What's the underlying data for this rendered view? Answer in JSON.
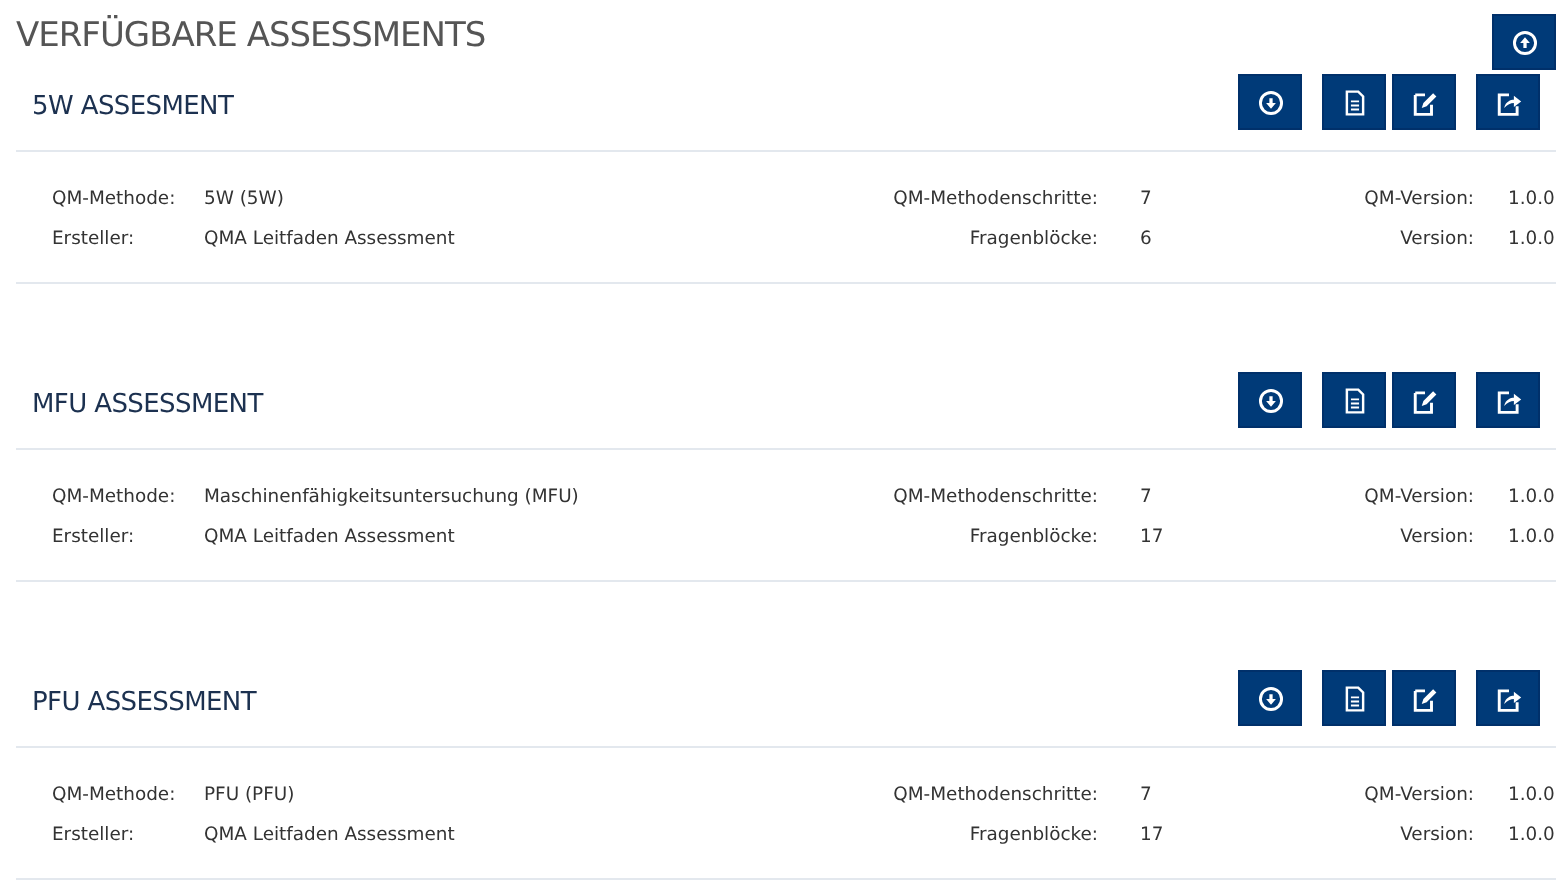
{
  "title": "VERFÜGBARE ASSESSMENTS",
  "header_action": {
    "kind": "upload"
  },
  "assessments": [
    {
      "name": "5W ASSESMENT",
      "actions": [
        {
          "kind": "download"
        },
        {
          "kind": "document"
        },
        {
          "kind": "edit"
        },
        {
          "kind": "export"
        }
      ],
      "fields": [
        [
          {
            "label": "QM-Methode:",
            "value": "5W (5W)"
          },
          {
            "label": "QM-Methodenschritte:",
            "value": "7"
          },
          {
            "label": "QM-Version:",
            "value": "1.0.0"
          }
        ],
        [
          {
            "label": "Ersteller:",
            "value": "QMA Leitfaden Assessment"
          },
          {
            "label": "Fragenblöcke:",
            "value": "6"
          },
          {
            "label": "Version:",
            "value": "1.0.0"
          }
        ]
      ]
    },
    {
      "name": "MFU ASSESSMENT",
      "actions": [
        {
          "kind": "download"
        },
        {
          "kind": "document"
        },
        {
          "kind": "edit"
        },
        {
          "kind": "export"
        }
      ],
      "fields": [
        [
          {
            "label": "QM-Methode:",
            "value": "Maschinenfähigkeitsuntersuchung (MFU)"
          },
          {
            "label": "QM-Methodenschritte:",
            "value": "7"
          },
          {
            "label": "QM-Version:",
            "value": "1.0.0"
          }
        ],
        [
          {
            "label": "Ersteller:",
            "value": "QMA Leitfaden Assessment"
          },
          {
            "label": "Fragenblöcke:",
            "value": "17"
          },
          {
            "label": "Version:",
            "value": "1.0.0"
          }
        ]
      ]
    },
    {
      "name": "PFU ASSESSMENT",
      "actions": [
        {
          "kind": "download"
        },
        {
          "kind": "document"
        },
        {
          "kind": "edit"
        },
        {
          "kind": "export"
        }
      ],
      "fields": [
        [
          {
            "label": "QM-Methode:",
            "value": "PFU (PFU)"
          },
          {
            "label": "QM-Methodenschritte:",
            "value": "7"
          },
          {
            "label": "QM-Version:",
            "value": "1.0.0"
          }
        ],
        [
          {
            "label": "Ersteller:",
            "value": "QMA Leitfaden Assessment"
          },
          {
            "label": "Fragenblöcke:",
            "value": "17"
          },
          {
            "label": "Version:",
            "value": "1.0.0"
          }
        ]
      ]
    }
  ]
}
